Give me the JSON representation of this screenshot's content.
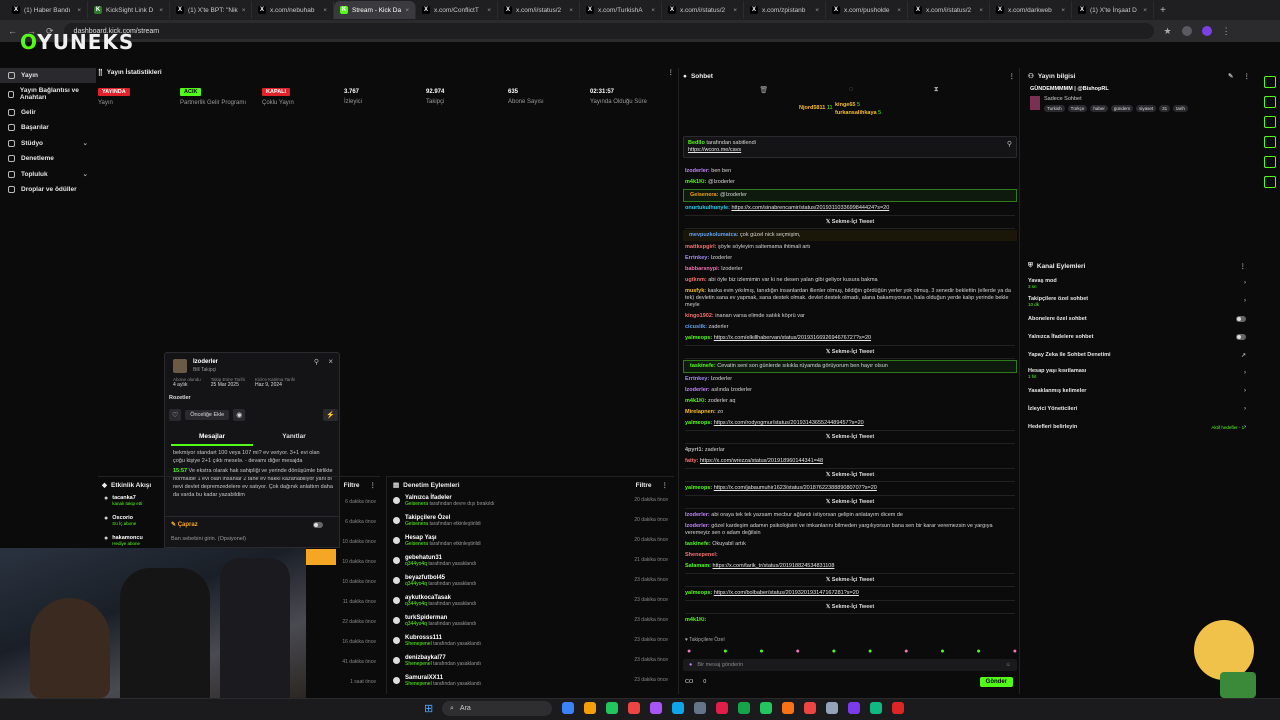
{
  "browser": {
    "tabs": [
      {
        "label": "(1) Haber Bandı",
        "fav": "X",
        "color": "#000000",
        "active": false
      },
      {
        "label": "KickSight Link D",
        "fav": "K",
        "color": "#2d7a2d",
        "active": false
      },
      {
        "label": "(1) X'te BPT: \"Nik",
        "fav": "X",
        "color": "#000000",
        "active": false
      },
      {
        "label": "x.com/nebuhab",
        "fav": "X",
        "color": "#000000",
        "active": false
      },
      {
        "label": "Stream - Kick Da",
        "fav": "K",
        "color": "#53fc18",
        "active": true
      },
      {
        "label": "x.com/ConflictT",
        "fav": "X",
        "color": "#000000",
        "active": false
      },
      {
        "label": "x.com/i/status/2",
        "fav": "X",
        "color": "#000000",
        "active": false
      },
      {
        "label": "x.com/TurkishA",
        "fav": "X",
        "color": "#000000",
        "active": false
      },
      {
        "label": "x.com/i/status/2",
        "fav": "X",
        "color": "#000000",
        "active": false
      },
      {
        "label": "x.com/zpistanb",
        "fav": "X",
        "color": "#000000",
        "active": false
      },
      {
        "label": "x.com/pusholde",
        "fav": "X",
        "color": "#000000",
        "active": false
      },
      {
        "label": "x.com/i/status/2",
        "fav": "X",
        "color": "#000000",
        "active": false
      },
      {
        "label": "x.com/darkweb",
        "fav": "X",
        "color": "#000000",
        "active": false
      },
      {
        "label": "(1) X'te İnşaat D",
        "fav": "X",
        "color": "#000000",
        "active": false
      }
    ],
    "url": "dashboard.kick.com/stream"
  },
  "logo": {
    "text_a": "",
    "text_o": "O",
    "text_b": "YUNEKS"
  },
  "sidebar": {
    "items": [
      {
        "label": "Yayın",
        "active": true,
        "chev": false
      },
      {
        "label": "Yayın Bağlantısı ve Anahtarı",
        "active": false,
        "chev": false
      },
      {
        "label": "Gelir",
        "active": false,
        "chev": false
      },
      {
        "label": "Başarılar",
        "active": false,
        "chev": false
      },
      {
        "label": "Stüdyo",
        "active": false,
        "chev": true
      },
      {
        "label": "Denetleme",
        "active": false,
        "chev": false
      },
      {
        "label": "Topluluk",
        "active": false,
        "chev": true
      },
      {
        "label": "Droplar ve ödüller",
        "active": false,
        "chev": false
      }
    ]
  },
  "stats": {
    "title": "Yayın İstatistikleri",
    "items": [
      {
        "value": "YAYINDA",
        "label": "Yayın",
        "badge_color": "#e0222a",
        "badge": true
      },
      {
        "value": "ACIK",
        "label": "Partnerlik Gelir Programı",
        "badge_color": "#53fc18",
        "badge": true
      },
      {
        "value": "KAPALI",
        "label": "Çoklu Yayın",
        "badge_color": "#e0222a",
        "badge": true
      },
      {
        "value": "3.767",
        "label": "İzleyici",
        "badge": false
      },
      {
        "value": "92.974",
        "label": "Takipçi",
        "badge": false
      },
      {
        "value": "635",
        "label": "Abone Sayısı",
        "badge": false
      },
      {
        "value": "02:31:57",
        "label": "Yayında Olduğu Süre",
        "badge": false
      }
    ]
  },
  "popup": {
    "username": "Izoderler",
    "sub": "Bill Takipçi",
    "fields": [
      {
        "k": "Abone olundu",
        "v": "4 aylık"
      },
      {
        "k": "Takip Etme Tarihi",
        "v": "25 Mar 2025"
      },
      {
        "k": "Kick'e Katılma Tarihi",
        "v": "Haz 9, 2024"
      }
    ],
    "rozetler": "Rozetler",
    "priority_button": "Önceliğe Ekle",
    "tab_messages": "Mesajlar",
    "tab_replies": "Yanıtlar",
    "msg1": "bekmiyor standart 100 veya 107 mi? ev veriyor. 3+1 evi olan çoğu kişiye 2+1 çıktı meselə. - devamı diğer mesajda",
    "msg2_time": "15:57",
    "msg2": "Ve ekstra olarak hak sahipliği ve yerinde dönüşümle birlikte normalde 1 evi olan insanlar 2 tane ev hakkı kazanabiliyor yani bi nevi devlet depremzedelere ev satıyor. Çok dağınık anlattım daha da varda bu kadar yazabildim",
    "action_label": "Çapraz",
    "reason_placeholder": "Ban sebebini girin. (Opsiyonel)"
  },
  "activity": {
    "title": "Etkinlik Akışı",
    "filter": "Filtre",
    "items": [
      {
        "name": "tacanka7",
        "sub": "kanalı takip etti",
        "time": "6 dakika önce"
      },
      {
        "name": "Oscorio",
        "sub": "Sü İç abone",
        "time": "6 dakika önce"
      },
      {
        "name": "hakamoncu",
        "sub": "Hediye abone",
        "time": "10 dakika önce"
      }
    ],
    "extra_times": [
      "10 dakika önce",
      "10 dakika önce",
      "11 dakika önce",
      "22 dakika önce",
      "16 dakika önce",
      "41 dakika önce",
      "1 saat önce"
    ]
  },
  "modlog": {
    "title": "Denetim Eylemleri",
    "filter": "Filtre",
    "items": [
      {
        "name": "Yalnızca İfadeler",
        "mod": "Geisenera",
        "action": "tarafından devre dışı bırakıldı",
        "time": "20 dakika önce"
      },
      {
        "name": "Takipçilere Özel",
        "mod": "Geisenera",
        "action": "tarafından etkinleştirildi",
        "time": "20 dakika önce"
      },
      {
        "name": "Hesap Yaşı",
        "mod": "Geisenera",
        "action": "tarafından etkinleştirildi",
        "time": "20 dakika önce"
      },
      {
        "name": "gebehatun31",
        "mod": "q344yo4q",
        "action": "tarafından yasaklandı",
        "time": "21 dakika önce"
      },
      {
        "name": "beyazfutbol45",
        "mod": "q344yo4q",
        "action": "tarafından yasaklandı",
        "time": "23 dakika önce"
      },
      {
        "name": "aykutkocaTasak",
        "mod": "q344yo4q",
        "action": "tarafından yasaklandı",
        "time": "23 dakika önce"
      },
      {
        "name": "turkSpiderman",
        "mod": "q344yo4q",
        "action": "tarafından yasaklandı",
        "time": "23 dakika önce"
      },
      {
        "name": "Kubrosss111",
        "mod": "Shenepenel",
        "action": "tarafından yasaklandı",
        "time": "23 dakika önce"
      },
      {
        "name": "denizbaykal77",
        "mod": "Shenepenel",
        "action": "tarafından yasaklandı",
        "time": "23 dakika önce"
      },
      {
        "name": "SamuraiXX11",
        "mod": "Shenepenel",
        "action": "tarafından yasaklandı",
        "time": "23 dakika önce"
      }
    ]
  },
  "chat": {
    "title": "Sohbet",
    "top_users": [
      {
        "name": "Njord5811",
        "count": "11"
      },
      {
        "name": "kinge65",
        "count": "5"
      },
      {
        "name": "furkansalihkaya",
        "count": "5"
      }
    ],
    "pinned_by": "tarafından sabitlendi",
    "pinned_user": "Bedllo",
    "pinned_link": "https://wcoro.me/cavs",
    "lines": [
      {
        "user": "Izoderler",
        "color": "#c084fc",
        "text": "ben ben"
      },
      {
        "user": "m4k1Ki",
        "color": "#53fc18",
        "text": "@Izoderler"
      },
      {
        "user": "Geisenera",
        "color": "#f59e0b",
        "text": "@Izoderler",
        "hl": true
      },
      {
        "user": "onurtukulhunyle",
        "color": "#22d3ee",
        "text": "",
        "link": "https://x.com/sinabrencamir/status/2019311033699844424?s=20"
      },
      {
        "embed": "Sekme-İçi Tweet"
      },
      {
        "user": "mevpuzkolumatca",
        "color": "#60a5fa",
        "text": "çok güzel nick seçmişim,",
        "hl2": true
      },
      {
        "user": "mattkspgirl",
        "color": "#f87171",
        "text": "şöyle söyleyim saltemama ihtimali artı"
      },
      {
        "user": "Errtnkey",
        "color": "#a78bfa",
        "text": "Izoderler"
      },
      {
        "user": "babbarsnypi",
        "color": "#f472b6",
        "text": "Izoderler"
      },
      {
        "user": "ugtknm",
        "color": "#f87171",
        "text": "abi öyle biz izlemimin var ki ne desen yalan gibi geliyor kusura bakma"
      },
      {
        "user": "musfyk",
        "color": "#fbbf24",
        "text": "kaska evin yıkılmış, tanıdığın insanlardan illenler olmuş, bildiğin gördüğün yerler yok olmuş. 3 senedir beklettin (ellerde ya da tek) devletin sana ev yapmak, sana destek olmak. devlet destek olmadı, alana bakamıyorsun, hala olduğun yerde kalıp yerinde bekle meyle"
      },
      {
        "user": "kingo1902",
        "color": "#f87171",
        "text": "inanan varsa elimde satılık köprü var"
      },
      {
        "user": "cicuslik",
        "color": "#60a5fa",
        "text": "zaderler"
      },
      {
        "user": "yalmeops",
        "color": "#53fc18",
        "text": "",
        "link": "https://x.com/elkillhabervan/status/2019316692694676727?s=20"
      },
      {
        "embed": "Sekme-İçi Tweet"
      },
      {
        "user": "taskinefe",
        "color": "#53fc18",
        "text": "Cevatin seni son günlerde sıkıkla rüyamda görüyorum ben hayır olsun",
        "hl": true
      },
      {
        "user": "Errtnkey",
        "color": "#a78bfa",
        "text": "Izoderler"
      },
      {
        "user": "Izoderler",
        "color": "#c084fc",
        "text": "aslında Izoderler"
      },
      {
        "user": "m4k1Ki",
        "color": "#53fc18",
        "text": "zoderler aq"
      },
      {
        "user": "Mirelapnen",
        "color": "#fbbf24",
        "text": "zo"
      },
      {
        "user": "yalmeops",
        "color": "#53fc18",
        "text": "",
        "link": "https://x.com/rodyogmur/status/2019314365524489457?s=20"
      },
      {
        "embed": "Sekme-İçi Tweet"
      },
      {
        "user": "4pyrt1",
        "color": "#bbb",
        "text": "zaderlar"
      },
      {
        "user": "fatty",
        "color": "#f87171",
        "text": "",
        "link": "https://x.com/wrezza/status/201918960144341=48"
      },
      {
        "embed": "Sekme-İçi Tweet"
      },
      {
        "user": "yalmeops",
        "color": "#53fc18",
        "text": "",
        "link": "https://x.com/jabaumuhir1623/status/2018762238889080707?s=20"
      },
      {
        "embed": "Sekme-İçi Tweet"
      },
      {
        "user": "Izoderler",
        "color": "#c084fc",
        "text": "abi oraya tek tek yazsam mecbur ağlandı istiyorsan gelipin anlatayım dicem de"
      },
      {
        "user": "Izoderler",
        "color": "#c084fc",
        "text": "gözel kardeşim adamın psikolojisini ve imkanlarını bilmeden yargılıyorsun bana sen bir karar veremezsin ve yargıya veremeyiz sen o adam değilsin"
      },
      {
        "user": "taskinefe",
        "color": "#53fc18",
        "text": "Okuyabil artık"
      },
      {
        "user": "Shenepenel",
        "color": "#f87171",
        "text": ""
      },
      {
        "user": "Salamam",
        "color": "#53fc18",
        "text": "",
        "link": "https://x.com/tarik_tr/status/201918824534831108"
      },
      {
        "embed": "Sekme-İçi Tweet"
      },
      {
        "user": "yalmeops",
        "color": "#53fc18",
        "text": "",
        "link": "https://x.com/bolbaber/status/2019320193147167281?s=20"
      },
      {
        "embed": "Sekme-İçi Tweet"
      },
      {
        "user": "m4k1Ki",
        "color": "#53fc18",
        "text": ""
      }
    ],
    "followers_only": "Takipçilere Özel",
    "input_placeholder": "Bir mesaj gönderin",
    "count_a": "CO",
    "count_b": "0",
    "send_button": "Gönder"
  },
  "stream_info": {
    "title": "Yayın bilgisi",
    "stream_title": "GÜNDEMMMMM | @BishopRL",
    "category": "Sadece Sohbet",
    "tags": [
      "Turkish",
      "Türkçe",
      "haber",
      "gündem",
      "siyaset",
      "31",
      "tarih"
    ]
  },
  "channel_actions": {
    "title": "Kanal Eylemleri",
    "rows": [
      {
        "label": "Yavaş mod",
        "sub": "3 sn",
        "ctrl": "chev"
      },
      {
        "label": "Takipçilere özel sohbet",
        "sub": "10 dk",
        "ctrl": "chev"
      },
      {
        "label": "Abonelere özel sohbet",
        "sub": "",
        "ctrl": "toggle"
      },
      {
        "label": "Yalnızca İfadelere sohbet",
        "sub": "",
        "ctrl": "toggle"
      },
      {
        "label": "Yapay Zeka ile Sohbet Denetimi",
        "sub": "",
        "ctrl": "ext"
      },
      {
        "label": "Hesap yaşı kısıtlaması",
        "sub": "1 hit",
        "ctrl": "chev"
      },
      {
        "label": "Yasaklanmış kelimeler",
        "sub": "",
        "ctrl": "chev"
      },
      {
        "label": "İzleyici Yöneticileri",
        "sub": "",
        "ctrl": "chev"
      },
      {
        "label": "Hedefleri belirleyin",
        "sub": "",
        "ctrl": "goal"
      }
    ],
    "goal_text": "Aktif hedefler - 1"
  },
  "taskbar": {
    "search_placeholder": "Ara"
  }
}
